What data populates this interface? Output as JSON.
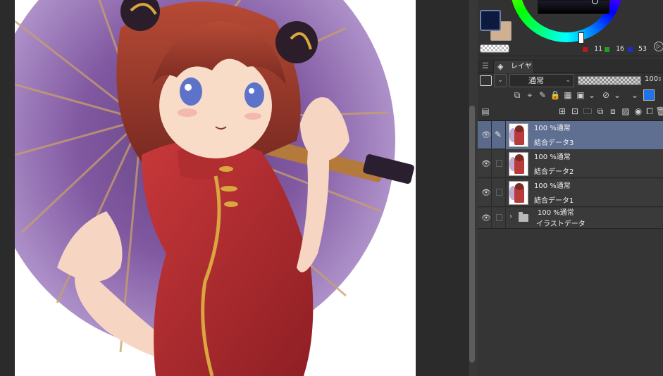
{
  "canvas": {
    "artwork_description_colors": {
      "umbrella": "#7b4f9c",
      "dress": "#b82c2e",
      "hair": "#9b3b2a",
      "skin": "#f6d6c2",
      "trim": "#d9a640"
    }
  },
  "color_panel": {
    "foreground": "#0d1a3f",
    "background": "#d0b08f",
    "rgb": {
      "r": "11",
      "g": "16",
      "b": "53"
    },
    "rgb_colors": {
      "r": "#c01818",
      "g": "#20a020",
      "b": "#1a30c0"
    }
  },
  "layer_panel": {
    "tab_label": "レイヤー",
    "blend_mode": "通常",
    "opacity": "100",
    "layers": [
      {
        "meta": "100 %通常",
        "name": "結合データ3",
        "selected": true
      },
      {
        "meta": "100 %通常",
        "name": "結合データ2",
        "selected": false
      },
      {
        "meta": "100 %通常",
        "name": "結合データ1",
        "selected": false
      }
    ],
    "folder": {
      "meta": "100 %通常",
      "name": "イラストデータ"
    }
  },
  "icons": {
    "tab_menu": "menu-icon",
    "tab_layer": "layers-icon",
    "eye": "eye-icon",
    "pen": "pen-icon",
    "folder": "folder-icon",
    "chevron": "chevron-right-icon"
  }
}
